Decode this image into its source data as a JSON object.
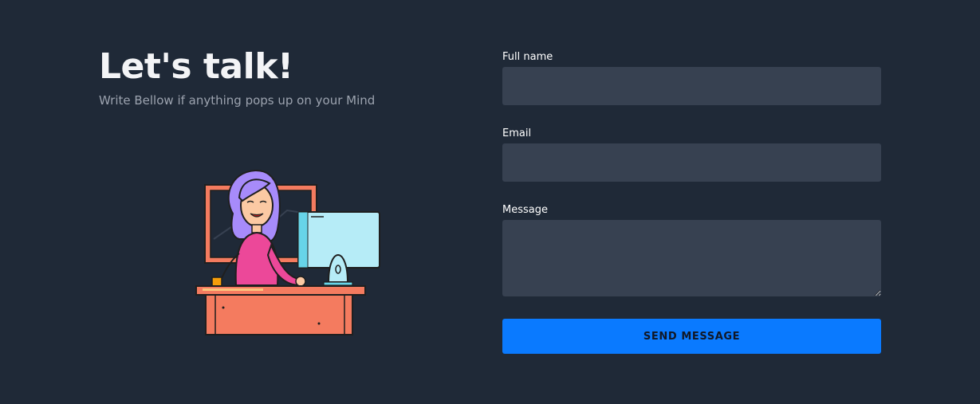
{
  "hero": {
    "title": "Let's talk!",
    "subtitle": "Write Bellow if anything pops up on your Mind"
  },
  "form": {
    "full_name": {
      "label": "Full name",
      "value": "",
      "placeholder": ""
    },
    "email": {
      "label": "Email",
      "value": "",
      "placeholder": ""
    },
    "message": {
      "label": "Message",
      "value": "",
      "placeholder": ""
    },
    "submit_label": "SEND MESSAGE"
  },
  "colors": {
    "background": "#1f2937",
    "input_background": "#374151",
    "accent": "#0a7aff",
    "subtitle": "#9ca3af"
  },
  "illustration": {
    "icon": "woman-at-desk-illustration"
  }
}
